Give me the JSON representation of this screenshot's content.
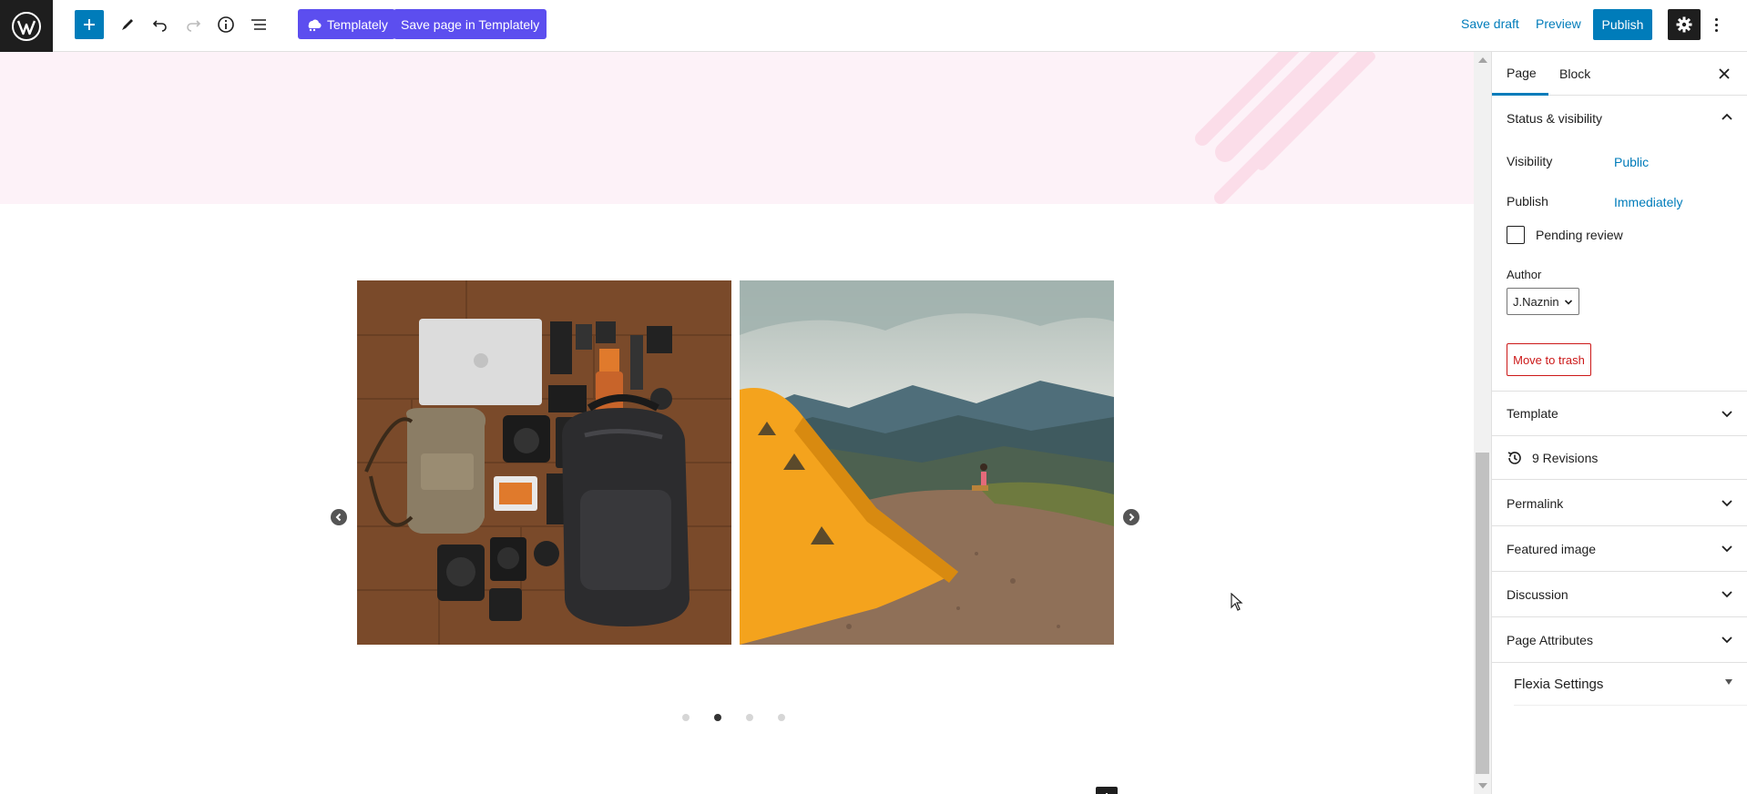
{
  "toolbar": {
    "logo_icon": "wordpress-logo",
    "add_icon": "plus-icon",
    "tools_icon": "pencil-icon",
    "undo_icon": "undo-icon",
    "redo_icon": "redo-icon",
    "details_icon": "info-icon",
    "list_view_icon": "list-view-icon",
    "templately_label": "Templately",
    "save_templately_label": "Save page in Templately",
    "save_draft_label": "Save draft",
    "preview_label": "Preview",
    "publish_label": "Publish",
    "settings_icon": "gear-icon",
    "more_icon": "kebab-menu-icon",
    "accent_color": "#007cba",
    "templately_color": "#5c4eef"
  },
  "canvas": {
    "hero_color": "#fdf2f8",
    "slider": {
      "slides": [
        {
          "name": "flatlay-camera-gear-photo"
        },
        {
          "name": "yellow-tent-mountain-photo"
        }
      ],
      "prev_icon": "chevron-left-icon",
      "next_icon": "chevron-right-icon",
      "dots_count": 4,
      "active_dot": 2
    },
    "block_inserter_icon": "plus-icon"
  },
  "sidebar": {
    "tabs": [
      {
        "label": "Page",
        "active": true
      },
      {
        "label": "Block",
        "active": false
      }
    ],
    "close_icon": "close-icon",
    "status_visibility": {
      "title": "Status & visibility",
      "visibility_label": "Visibility",
      "visibility_value": "Public",
      "publish_label": "Publish",
      "publish_value": "Immediately",
      "pending_review_label": "Pending review",
      "pending_review_checked": false,
      "author_label": "Author",
      "author_value": "J.Naznin",
      "trash_label": "Move to trash"
    },
    "panels": [
      {
        "title": "Template"
      },
      {
        "title": "Permalink"
      },
      {
        "title": "Featured image"
      },
      {
        "title": "Discussion"
      },
      {
        "title": "Page Attributes"
      }
    ],
    "revisions_label": "9 Revisions",
    "revisions_icon": "history-icon",
    "flexia_label": "Flexia Settings"
  }
}
